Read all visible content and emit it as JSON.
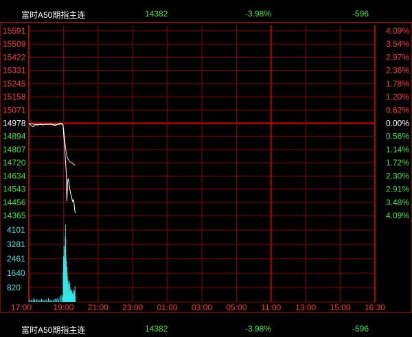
{
  "header": {
    "name": "富时A50期指主连",
    "price": "14382",
    "change_pct": "-3.98%",
    "change": "-596"
  },
  "colors": {
    "background": "#000000",
    "grid": "#8b0000",
    "grid_mid": "#dd0000",
    "price_line": "#ffffff",
    "avg_line": "#ffffff",
    "up": "#ff3333",
    "down": "#33e633",
    "flat": "#ffffff",
    "volume": "#33e6e6",
    "axis_text": "#ff3333",
    "volume_text": "#33e6e6"
  },
  "chart_data": {
    "type": "line",
    "price_axis": {
      "ticks": [
        "15591",
        "15509",
        "15422",
        "15331",
        "15245",
        "15158",
        "15071",
        "14978",
        "14894",
        "14807",
        "14720",
        "14634",
        "14543",
        "14456",
        "14365"
      ],
      "reference": "14978"
    },
    "percent_axis": {
      "ticks": [
        "4.09%",
        "3.54%",
        "2.97%",
        "2.36%",
        "1.78%",
        "1.20%",
        "0.62%",
        "0.00%",
        "0.56%",
        "1.14%",
        "1.72%",
        "2.30%",
        "2.91%",
        "3.48%",
        "4.09%"
      ]
    },
    "volume_axis": {
      "ticks": [
        "4101",
        "3281",
        "2461",
        "1640",
        "820"
      ],
      "max": 4920
    },
    "x_labels": [
      "17:00",
      "19:00",
      "21:00",
      "23:00",
      "01:00",
      "03:00",
      "05:00",
      "11:00",
      "13:00",
      "15:00",
      "16:30"
    ],
    "price_series": [
      [
        0,
        14978
      ],
      [
        5,
        14968
      ],
      [
        10,
        14960
      ],
      [
        15,
        14955
      ],
      [
        20,
        14964
      ],
      [
        25,
        14970
      ],
      [
        30,
        14965
      ],
      [
        35,
        14968
      ],
      [
        40,
        14972
      ],
      [
        45,
        14970
      ],
      [
        50,
        14966
      ],
      [
        55,
        14970
      ],
      [
        60,
        14972
      ],
      [
        65,
        14969
      ],
      [
        70,
        14972
      ],
      [
        75,
        14974
      ],
      [
        80,
        14970
      ],
      [
        85,
        14966
      ],
      [
        90,
        14962
      ],
      [
        95,
        14966
      ],
      [
        100,
        14970
      ],
      [
        105,
        14976
      ],
      [
        110,
        14980
      ],
      [
        115,
        14976
      ],
      [
        118,
        14972
      ],
      [
        120,
        14920
      ],
      [
        123,
        14850
      ],
      [
        126,
        14760
      ],
      [
        128,
        14700
      ],
      [
        130,
        14640
      ],
      [
        131,
        14520
      ],
      [
        132,
        14460
      ],
      [
        134,
        14570
      ],
      [
        136,
        14610
      ],
      [
        138,
        14600
      ],
      [
        140,
        14570
      ],
      [
        142,
        14540
      ],
      [
        144,
        14520
      ],
      [
        146,
        14500
      ],
      [
        148,
        14490
      ],
      [
        150,
        14470
      ],
      [
        152,
        14455
      ],
      [
        154,
        14470
      ],
      [
        156,
        14460
      ],
      [
        158,
        14420
      ],
      [
        160,
        14390
      ],
      [
        161,
        14382
      ]
    ],
    "avg_series": [
      [
        0,
        14976
      ],
      [
        20,
        14970
      ],
      [
        40,
        14969
      ],
      [
        60,
        14970
      ],
      [
        80,
        14970
      ],
      [
        100,
        14970
      ],
      [
        115,
        14972
      ],
      [
        118,
        14970
      ],
      [
        121,
        14930
      ],
      [
        124,
        14880
      ],
      [
        127,
        14820
      ],
      [
        130,
        14780
      ],
      [
        134,
        14745
      ],
      [
        140,
        14728
      ],
      [
        146,
        14718
      ],
      [
        152,
        14710
      ],
      [
        158,
        14702
      ],
      [
        161,
        14700
      ]
    ],
    "volume": [
      [
        0,
        60
      ],
      [
        4,
        150
      ],
      [
        8,
        120
      ],
      [
        12,
        90
      ],
      [
        16,
        200
      ],
      [
        20,
        140
      ],
      [
        24,
        110
      ],
      [
        28,
        160
      ],
      [
        32,
        90
      ],
      [
        36,
        130
      ],
      [
        40,
        100
      ],
      [
        44,
        180
      ],
      [
        48,
        120
      ],
      [
        52,
        80
      ],
      [
        56,
        110
      ],
      [
        60,
        140
      ],
      [
        64,
        100
      ],
      [
        68,
        220
      ],
      [
        72,
        130
      ],
      [
        76,
        120
      ],
      [
        80,
        90
      ],
      [
        84,
        110
      ],
      [
        88,
        150
      ],
      [
        92,
        180
      ],
      [
        96,
        170
      ],
      [
        100,
        250
      ],
      [
        104,
        130
      ],
      [
        108,
        320
      ],
      [
        112,
        400
      ],
      [
        116,
        290
      ],
      [
        118,
        380
      ],
      [
        119,
        1700
      ],
      [
        120,
        2600
      ],
      [
        121,
        2000
      ],
      [
        122,
        3200
      ],
      [
        123,
        2500
      ],
      [
        124,
        2200
      ],
      [
        125,
        3000
      ],
      [
        126,
        3750
      ],
      [
        127,
        4400
      ],
      [
        128,
        3600
      ],
      [
        129,
        2600
      ],
      [
        130,
        2300
      ],
      [
        131,
        1600
      ],
      [
        132,
        2000
      ],
      [
        133,
        1700
      ],
      [
        134,
        1400
      ],
      [
        135,
        800
      ],
      [
        136,
        1200
      ],
      [
        137,
        1000
      ],
      [
        138,
        600
      ],
      [
        139,
        500
      ],
      [
        140,
        1200
      ],
      [
        141,
        950
      ],
      [
        142,
        1100
      ],
      [
        143,
        850
      ],
      [
        144,
        700
      ],
      [
        145,
        450
      ],
      [
        146,
        650
      ],
      [
        147,
        520
      ],
      [
        148,
        700
      ],
      [
        149,
        420
      ],
      [
        150,
        600
      ],
      [
        151,
        350
      ],
      [
        152,
        500
      ],
      [
        153,
        300
      ],
      [
        154,
        450
      ],
      [
        155,
        280
      ],
      [
        156,
        700
      ],
      [
        157,
        650
      ],
      [
        158,
        200
      ],
      [
        159,
        600
      ],
      [
        160,
        900
      ],
      [
        161,
        350
      ]
    ]
  }
}
